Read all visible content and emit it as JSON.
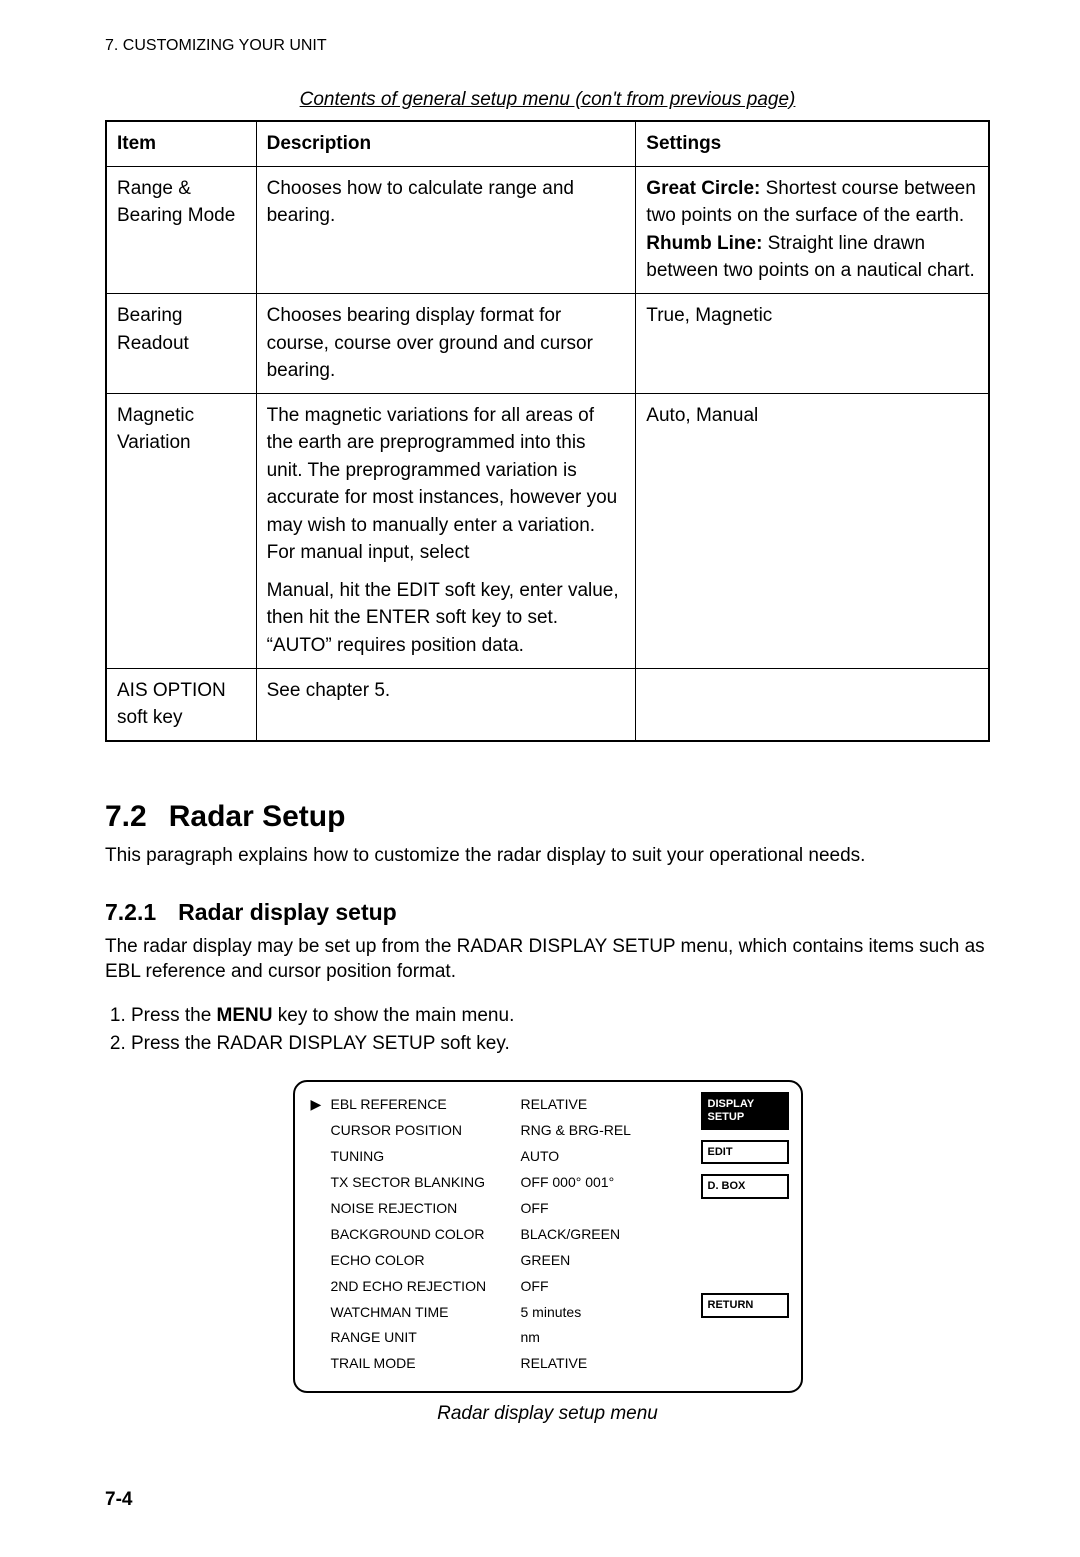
{
  "header": {
    "section": "7. CUSTOMIZING YOUR UNIT"
  },
  "table": {
    "caption": "Contents of general setup menu (con't from previous page)",
    "headers": {
      "item": "Item",
      "description": "Description",
      "settings": "Settings"
    },
    "rows": [
      {
        "item": "Range & Bearing Mode",
        "description": "Chooses how to calculate range and bearing.",
        "settings_bold1": "Great Circle:",
        "settings_text1": " Shortest course between two points on the surface of the earth.",
        "settings_bold2": "Rhumb Line:",
        "settings_text2": " Straight line drawn between two points on a nautical chart."
      },
      {
        "item": "Bearing Readout",
        "description": "Chooses bearing display format for course, course over ground and cursor bearing.",
        "settings_simple": "True, Magnetic"
      },
      {
        "item": "Magnetic Variation",
        "description_p1": "The magnetic variations for all areas of the earth are preprogrammed into this unit. The preprogrammed variation is accurate for most instances, however you may wish to manually enter a variation. For manual input, select",
        "description_p2": "Manual, hit the EDIT soft key, enter value, then hit the ENTER soft key to set. “AUTO” requires position data.",
        "settings_simple": "Auto, Manual"
      },
      {
        "item": "AIS OPTION soft key",
        "description": "See chapter 5.",
        "settings_simple": ""
      }
    ]
  },
  "section": {
    "number": "7.2",
    "title": "Radar Setup",
    "lead": "This paragraph explains how to customize the radar display to suit your operational needs."
  },
  "subsection": {
    "number": "7.2.1",
    "title": "Radar display setup",
    "body": "The radar display may be set up from the RADAR DISPLAY SETUP menu, which contains items such as EBL reference and cursor position format.",
    "steps": [
      {
        "pre": "Press the ",
        "bold": "MENU",
        "post": " key to show the main menu."
      },
      {
        "line": "Press the RADAR DISPLAY SETUP soft key."
      }
    ]
  },
  "menu": {
    "rows": [
      {
        "label": "EBL REFERENCE",
        "value": "RELATIVE",
        "cursor": true
      },
      {
        "label": "CURSOR POSITION",
        "value": "RNG & BRG-REL"
      },
      {
        "label": "TUNING",
        "value": "AUTO"
      },
      {
        "label": "TX SECTOR BLANKING",
        "value": "OFF  000°  001°"
      },
      {
        "label": "NOISE REJECTION",
        "value": "OFF"
      },
      {
        "label": "BACKGROUND COLOR",
        "value": "BLACK/GREEN"
      },
      {
        "label": "ECHO COLOR",
        "value": "GREEN"
      },
      {
        "label": "2ND ECHO REJECTION",
        "value": "OFF"
      },
      {
        "label": "WATCHMAN TIME",
        "value": "5 minutes"
      },
      {
        "label": "RANGE UNIT",
        "value": "nm"
      },
      {
        "label": "TRAIL MODE",
        "value": "RELATIVE"
      }
    ],
    "softkeys": {
      "display_setup_l1": "DISPLAY",
      "display_setup_l2": "SETUP",
      "edit": "EDIT",
      "dbox": "D. BOX",
      "return": "RETURN"
    },
    "caption": "Radar display setup menu"
  },
  "page": "7-4"
}
